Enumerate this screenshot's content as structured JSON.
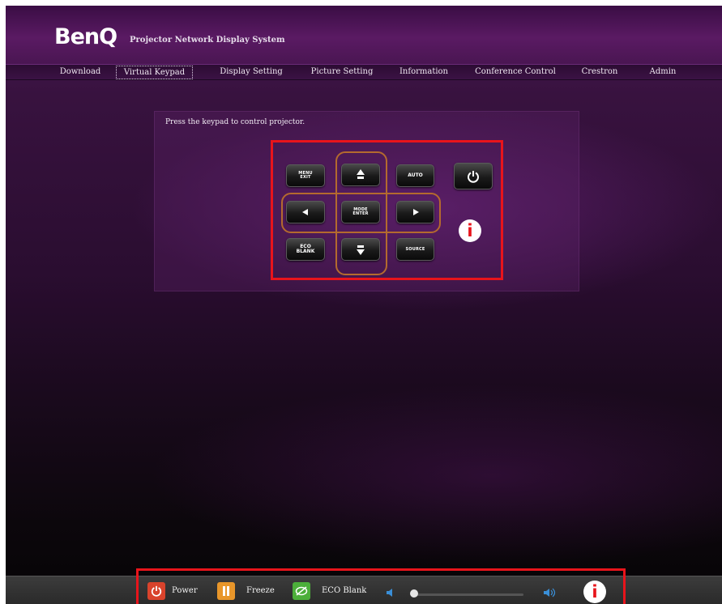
{
  "header": {
    "logo_text": "BenQ",
    "app_title": "Projector Network Display System"
  },
  "nav": {
    "items": [
      {
        "label": "Download"
      },
      {
        "label": "Virtual Keypad"
      },
      {
        "label": "Display Setting"
      },
      {
        "label": "Picture Setting"
      },
      {
        "label": "Information"
      },
      {
        "label": "Conference Control"
      },
      {
        "label": "Crestron"
      },
      {
        "label": "Admin"
      }
    ],
    "active_index": 1
  },
  "keypad": {
    "instruction": "Press the keypad to control projector.",
    "menu_line1": "MENU",
    "menu_line2": "EXIT",
    "auto_label": "AUTO",
    "mode_line1": "MODE",
    "mode_line2": "ENTER",
    "eco_line1": "ECO",
    "eco_line2": "BLANK",
    "source_label": "SOURCE",
    "power_icon": "power-icon",
    "arrow_up_icon": "arrow-up-icon",
    "arrow_down_icon": "arrow-down-icon",
    "arrow_left_icon": "arrow-left-icon",
    "arrow_right_icon": "arrow-right-icon"
  },
  "annotations": {
    "info_badge_text": "i",
    "highlight_color": "#e8141b"
  },
  "bottom_bar": {
    "power_label": "Power",
    "freeze_label": "Freeze",
    "eco_blank_label": "ECO Blank",
    "power_color": "#d9432c",
    "freeze_color": "#e8962a",
    "eco_color": "#4caf3a",
    "volume": 0.0
  }
}
